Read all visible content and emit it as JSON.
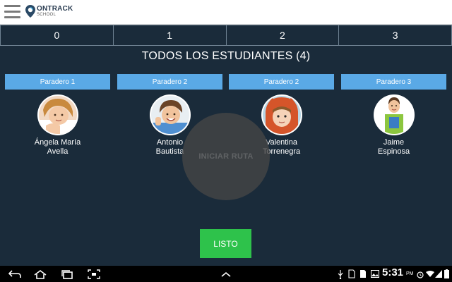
{
  "app": {
    "brand_on": "ON",
    "brand_track": "TRACK",
    "brand_sub": "SCHOOL"
  },
  "tabs": [
    {
      "label": "0"
    },
    {
      "label": "1"
    },
    {
      "label": "2"
    },
    {
      "label": "3"
    }
  ],
  "title": "TODOS LOS ESTUDIANTES (4)",
  "students": [
    {
      "stop": "Paradero 1",
      "name_line1": "Ángela María",
      "name_line2": "Avella"
    },
    {
      "stop": "Paradero 2",
      "name_line1": "Antonio",
      "name_line2": "Bautista"
    },
    {
      "stop": "Paradero 2",
      "name_line1": "Valentina",
      "name_line2": "Torrenegra"
    },
    {
      "stop": "Paradero 3",
      "name_line1": "Jaime",
      "name_line2": "Espinosa"
    }
  ],
  "overlay": {
    "label": "INICIAR RUTA"
  },
  "done_label": "LISTO",
  "status_bar": {
    "time": "5:31",
    "ampm": "PM"
  },
  "icons": {
    "menu": "hamburger-menu-icon",
    "back": "back-icon",
    "home": "home-icon",
    "recents": "recent-apps-icon",
    "screenshot": "screenshot-icon",
    "up": "chevron-up-icon",
    "usb": "usb-icon",
    "sd": "sd-card-icon",
    "image": "image-icon",
    "wifi": "wifi-icon",
    "signal": "signal-icon",
    "battery": "battery-icon",
    "alarm": "alarm-icon"
  },
  "colors": {
    "background": "#1a2b3a",
    "stop_badge": "#5aa9e6",
    "done_button": "#2ec24b",
    "tab_border": "#6f8292"
  }
}
